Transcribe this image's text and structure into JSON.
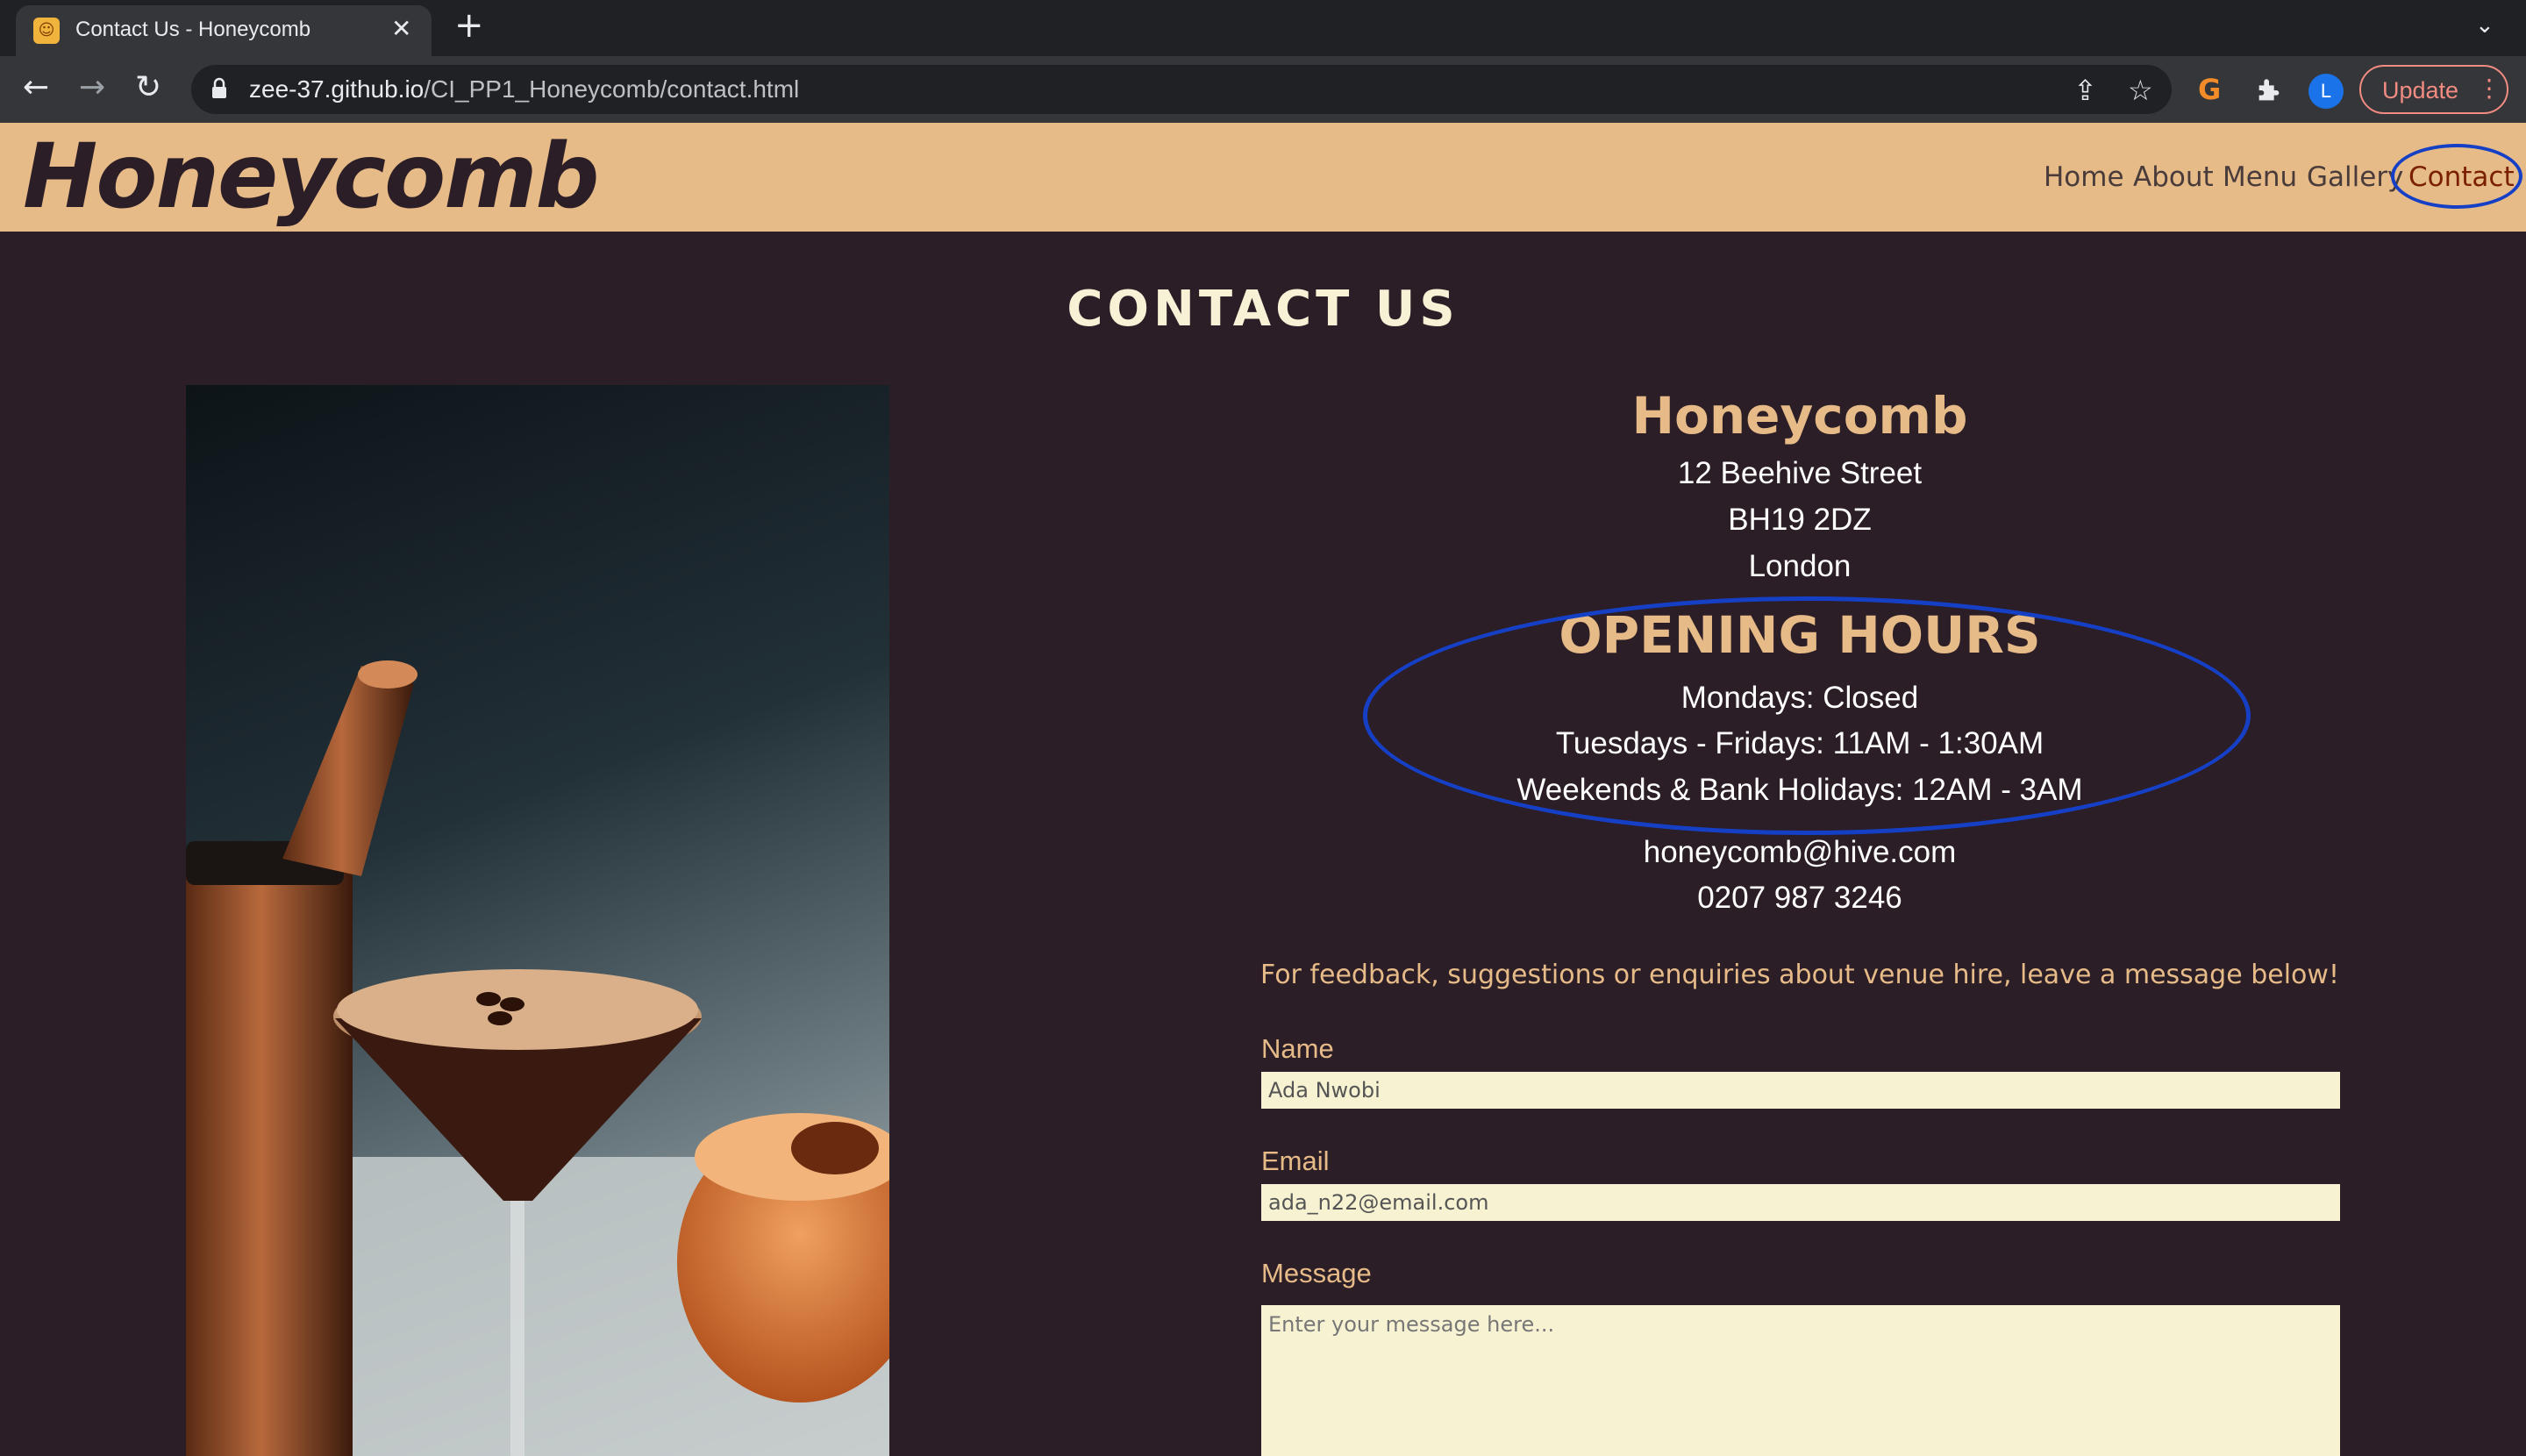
{
  "browser": {
    "tab_title": "Contact Us - Honeycomb",
    "tab_close": "✕",
    "new_tab": "+",
    "tab_search": "⌄",
    "url_host": "zee-37.github.io",
    "url_path": "/CI_PP1_Honeycomb/contact.html",
    "profile_initial": "L",
    "update_label": "Update",
    "icons": [
      "back-icon",
      "forward-icon",
      "reload-icon",
      "lock-icon",
      "share-icon",
      "star-icon",
      "extension-g-icon",
      "puzzle-icon",
      "menu-dots-icon"
    ]
  },
  "site": {
    "logo": "Honeycomb",
    "nav": [
      {
        "label": "Home"
      },
      {
        "label": "About"
      },
      {
        "label": "Menu"
      },
      {
        "label": "Gallery"
      },
      {
        "label": "Contact"
      }
    ],
    "active_nav": "Contact"
  },
  "main": {
    "page_title": "CONTACT US",
    "venue_name": "Honeycomb",
    "address": [
      "12 Beehive Street",
      "BH19 2DZ",
      "London"
    ],
    "hours_title": "OPENING HOURS",
    "hours": [
      "Mondays: Closed",
      "Tuesdays - Fridays: 11AM - 1:30AM",
      "Weekends & Bank Holidays: 12AM - 3AM"
    ],
    "email": "honeycomb@hive.com",
    "phone": "0207 987 3246",
    "feedback": "For feedback, suggestions or enquiries about venue hire, leave a message below!",
    "form": {
      "name_label": "Name",
      "name_value": "Ada Nwobi",
      "email_label": "Email",
      "email_value": "ada_n22@email.com",
      "message_label": "Message",
      "message_placeholder": "Enter your message here..."
    }
  },
  "colors": {
    "page_bg": "#2c1e27",
    "header_bg": "#e6bb88",
    "accent": "#e6bb88",
    "input_bg": "#f7f3d2",
    "annotation": "#1540c6"
  }
}
